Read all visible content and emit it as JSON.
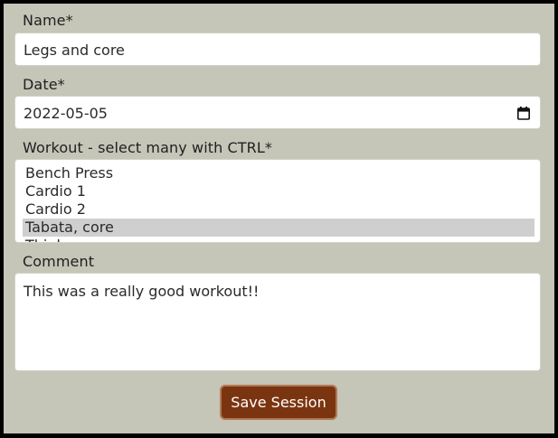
{
  "form": {
    "name_label": "Name*",
    "name_value": "Legs and core",
    "date_label": "Date*",
    "date_value": "2022-05-05",
    "workout_label": "Workout - select many with CTRL*",
    "workout_options": [
      {
        "label": "Bench Press",
        "selected": false
      },
      {
        "label": "Cardio 1",
        "selected": false
      },
      {
        "label": "Cardio 2",
        "selected": false
      },
      {
        "label": "Tabata, core",
        "selected": true
      },
      {
        "label": "Thighs",
        "selected": false
      }
    ],
    "comment_label": "Comment",
    "comment_value": "This was a really good workout!!",
    "save_label": "Save Session"
  },
  "icons": {
    "date_picker": "calendar-icon"
  },
  "colors": {
    "background": "#c5c5b8",
    "button": "#7a3510",
    "selected_option": "#cfcfcf"
  }
}
